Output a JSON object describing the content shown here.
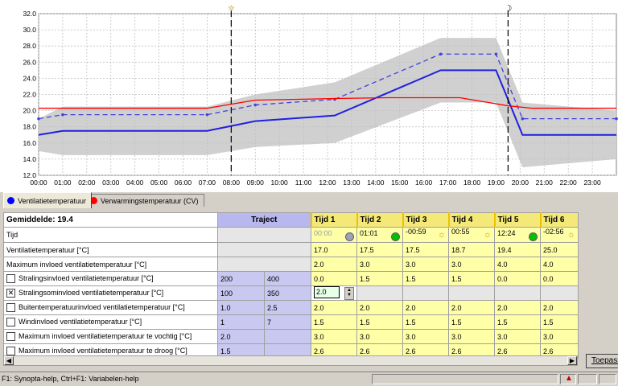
{
  "chart_data": {
    "type": "line",
    "y_ticks": [
      "32.0",
      "30.0",
      "28.0",
      "26.0",
      "24.0",
      "22.0",
      "20.0",
      "18.0",
      "16.0",
      "14.0",
      "12.0"
    ],
    "x_ticks": [
      "00:00",
      "01:00",
      "02:00",
      "03:00",
      "04:00",
      "05:00",
      "06:00",
      "07:00",
      "08:00",
      "09:00",
      "10:00",
      "11:00",
      "12:00",
      "13:00",
      "14:00",
      "15:00",
      "16:00",
      "17:00",
      "18:00",
      "19:00",
      "20:00",
      "21:00",
      "22:00",
      "23:00"
    ],
    "xlim": [
      0,
      24
    ],
    "ylim": [
      12,
      32
    ],
    "grid": true,
    "series": [
      {
        "color": "#2020e0",
        "style": "solid",
        "x": [
          0,
          1,
          7,
          9,
          12.3,
          16.7,
          19,
          20.1,
          24
        ],
        "y": [
          17.0,
          17.5,
          17.5,
          18.7,
          19.4,
          25.0,
          25.0,
          17.0,
          17.0
        ]
      },
      {
        "color": "#4040e0",
        "style": "dashed",
        "x": [
          0,
          1,
          7,
          9,
          12.3,
          16.7,
          19,
          20.1,
          24
        ],
        "y": [
          19.0,
          19.5,
          19.5,
          20.7,
          21.4,
          27.0,
          27.0,
          19.0,
          19.0
        ]
      },
      {
        "color": "#ff0000",
        "style": "solid",
        "x": [
          0,
          1,
          7,
          9,
          12.3,
          14.5,
          17.5,
          19.5,
          20.5,
          24
        ],
        "y": [
          20.3,
          20.3,
          20.3,
          21.3,
          21.5,
          21.6,
          21.6,
          20.6,
          20.3,
          20.3
        ]
      }
    ],
    "band": {
      "color": "#d0d0d0",
      "x": [
        0,
        1,
        7,
        9,
        12.3,
        16.7,
        19,
        20.1,
        24
      ],
      "upper": [
        19.0,
        20.5,
        20.5,
        22.0,
        23.5,
        29.0,
        29.0,
        21.0,
        20.0
      ],
      "lower": [
        15.0,
        14.5,
        14.5,
        15.5,
        16.0,
        21.0,
        21.0,
        13.0,
        14.0
      ]
    },
    "markers": [
      {
        "x": 8.0,
        "icon": "sun"
      },
      {
        "x": 19.5,
        "icon": "moon"
      }
    ]
  },
  "tabs": [
    {
      "label": "Ventilatietemperatuur",
      "color": "#0000ff"
    },
    {
      "label": "Verwarmingstemperatuur (CV)",
      "color": "#ff0000"
    }
  ],
  "table": {
    "corner": "Gemiddelde: 19.4",
    "traject_header": "Traject",
    "tijd_headers": [
      "Tijd 1",
      "Tijd 2",
      "Tijd 3",
      "Tijd 4",
      "Tijd 5",
      "Tijd 6"
    ],
    "tijd_row": {
      "label": "Tijd",
      "values": [
        "00:00",
        "01:01",
        "-00:59",
        "00:55",
        "12:24",
        "-02:56"
      ],
      "icons": [
        "gray-dot",
        "green-dot",
        "sun",
        "sun",
        "green-dot",
        "sun"
      ],
      "dim": [
        true,
        false,
        false,
        false,
        false,
        false
      ]
    },
    "rows": [
      {
        "label": "Ventilatietemperatuur [°C]",
        "checkbox": null,
        "traj": [
          "",
          ""
        ],
        "values": [
          "17.0",
          "17.5",
          "17.5",
          "18.7",
          "19.4",
          "25.0"
        ]
      },
      {
        "label": "Maximum invloed ventilatietemperatuur [°C]",
        "checkbox": null,
        "traj": [
          "",
          ""
        ],
        "values": [
          "2.0",
          "3.0",
          "3.0",
          "3.0",
          "4.0",
          "4.0"
        ]
      },
      {
        "label": "Stralingsinvloed ventilatietemperatuur [°C]",
        "checkbox": false,
        "traj": [
          "200",
          "400"
        ],
        "values": [
          "0.0",
          "1.5",
          "1.5",
          "1.5",
          "0.0",
          "0.0"
        ]
      },
      {
        "label": "Stralingsominvloed ventilatietemperatuur [°C]",
        "checkbox": true,
        "traj": [
          "100",
          "350"
        ],
        "values": [
          "2.0",
          "",
          "",
          "",
          "",
          ""
        ]
      },
      {
        "label": "Buitentemperatuurinvloed ventilatietemperatuur [°C]",
        "checkbox": false,
        "traj": [
          "1.0",
          "2.5"
        ],
        "values": [
          "2.0",
          "2.0",
          "2.0",
          "2.0",
          "2.0",
          "2.0"
        ]
      },
      {
        "label": "Windinvloed ventilatietemperatuur [°C]",
        "checkbox": false,
        "traj": [
          "1",
          "7"
        ],
        "values": [
          "1.5",
          "1.5",
          "1.5",
          "1.5",
          "1.5",
          "1.5"
        ]
      },
      {
        "label": "Maximum invloed ventilatietemperatuur te vochtig [°C]",
        "checkbox": false,
        "traj": [
          "2.0",
          ""
        ],
        "values": [
          "3.0",
          "3.0",
          "3.0",
          "3.0",
          "3.0",
          "3.0"
        ]
      },
      {
        "label": "Maximum invloed ventilatietemperatuur te droog [°C]",
        "checkbox": false,
        "traj": [
          "1.5",
          ""
        ],
        "values": [
          "2.6",
          "2.6",
          "2.6",
          "2.6",
          "2.6",
          "2.6"
        ]
      }
    ]
  },
  "apply_button": "Toepasse",
  "status_text": "F1: Synopta-help, Ctrl+F1: Variabelen-help"
}
